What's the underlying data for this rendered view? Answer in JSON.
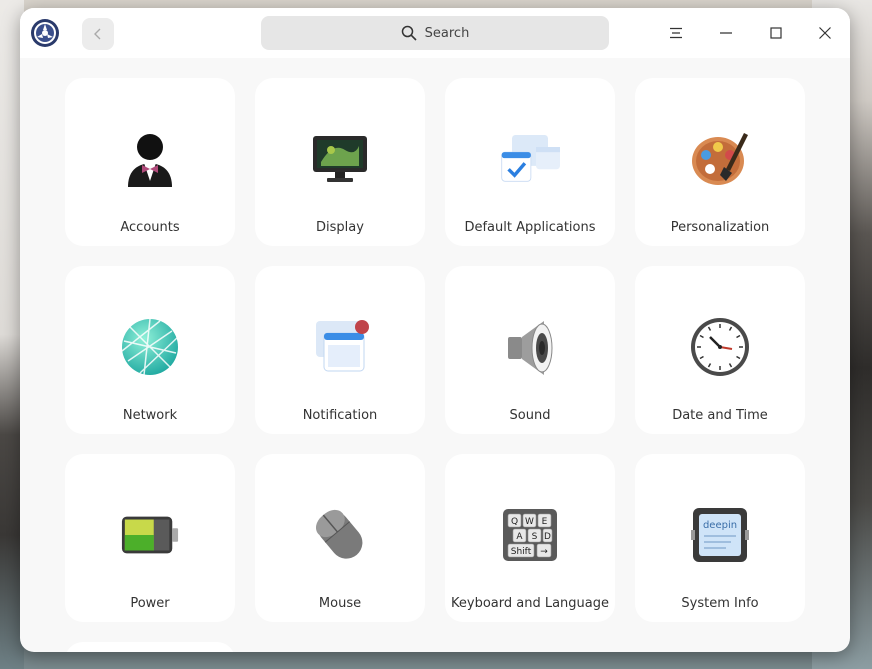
{
  "search": {
    "placeholder": "Search"
  },
  "modules": [
    {
      "label": "Accounts",
      "icon": "accounts-icon"
    },
    {
      "label": "Display",
      "icon": "display-icon"
    },
    {
      "label": "Default Applications",
      "icon": "default-applications-icon"
    },
    {
      "label": "Personalization",
      "icon": "personalization-icon"
    },
    {
      "label": "Network",
      "icon": "network-icon"
    },
    {
      "label": "Notification",
      "icon": "notification-icon"
    },
    {
      "label": "Sound",
      "icon": "sound-icon"
    },
    {
      "label": "Date and Time",
      "icon": "clock-icon"
    },
    {
      "label": "Power",
      "icon": "battery-icon"
    },
    {
      "label": "Mouse",
      "icon": "mouse-icon"
    },
    {
      "label": "Keyboard and Language",
      "icon": "keyboard-icon"
    },
    {
      "label": "System Info",
      "icon": "system-info-icon"
    }
  ],
  "keyboard_keys": [
    "Q",
    "W",
    "E",
    "A",
    "S",
    "D",
    "Shift",
    "→"
  ],
  "system_info_brand": "deepin"
}
